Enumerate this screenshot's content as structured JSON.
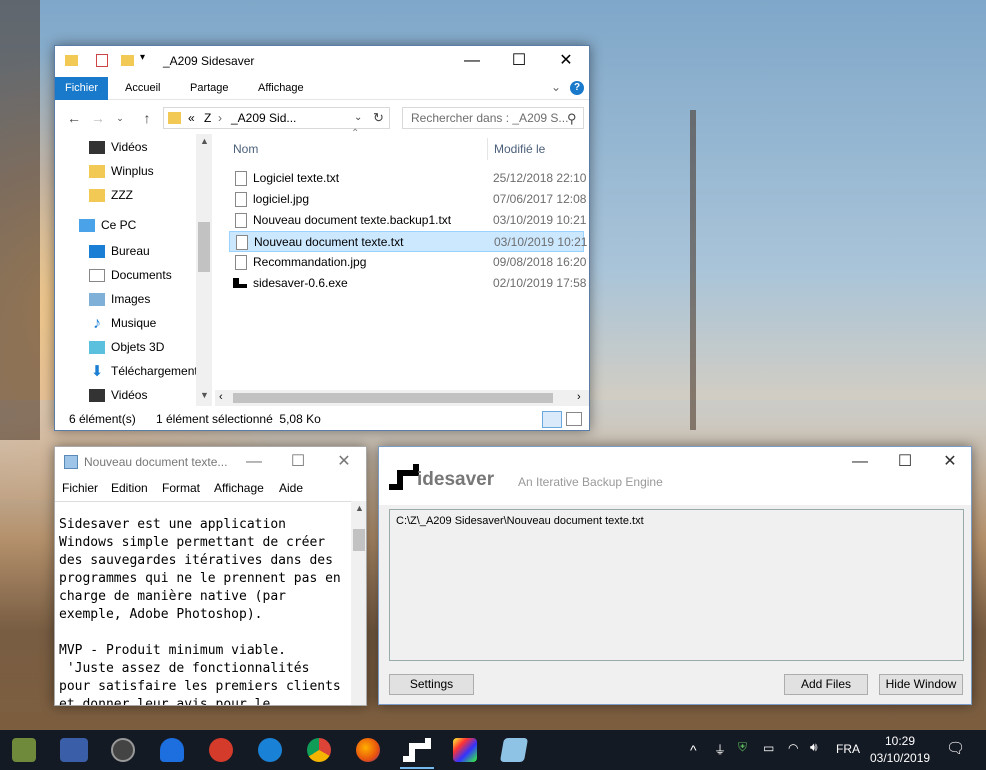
{
  "explorer": {
    "title": "_A209 Sidesaver",
    "tabs": [
      "Fichier",
      "Accueil",
      "Partage",
      "Affichage"
    ],
    "breadcrumb": [
      "«",
      "Z",
      "_A209 Sid..."
    ],
    "search_placeholder": "Rechercher dans : _A209 S...",
    "nav_items": [
      {
        "label": "Vidéos",
        "icon": "video-icon"
      },
      {
        "label": "Winplus",
        "icon": "folder-icon"
      },
      {
        "label": "ZZZ",
        "icon": "folder-icon"
      },
      {
        "label": "Ce PC",
        "icon": "computer-icon"
      },
      {
        "label": "Bureau",
        "icon": "desktop-icon"
      },
      {
        "label": "Documents",
        "icon": "documents-icon"
      },
      {
        "label": "Images",
        "icon": "images-icon"
      },
      {
        "label": "Musique",
        "icon": "music-icon"
      },
      {
        "label": "Objets 3D",
        "icon": "objects3d-icon"
      },
      {
        "label": "Téléchargements",
        "icon": "download-icon"
      },
      {
        "label": "Vidéos",
        "icon": "video-icon"
      }
    ],
    "columns": {
      "name": "Nom",
      "modified": "Modifié le"
    },
    "files": [
      {
        "name": "Logiciel texte.txt",
        "date": "25/12/2018 22:10"
      },
      {
        "name": "logiciel.jpg",
        "date": "07/06/2017 12:08"
      },
      {
        "name": "Nouveau document texte.backup1.txt",
        "date": "03/10/2019 10:21"
      },
      {
        "name": "Nouveau document texte.txt",
        "date": "03/10/2019 10:21"
      },
      {
        "name": "Recommandation.jpg",
        "date": "09/08/2018 16:20"
      },
      {
        "name": "sidesaver-0.6.exe",
        "date": "02/10/2019 17:58"
      }
    ],
    "selected_index": 3,
    "status_count": "6 élément(s)",
    "status_selection": "1 élément sélectionné  5,08 Ko"
  },
  "notepad": {
    "title": "Nouveau document texte...",
    "menu": [
      "Fichier",
      "Edition",
      "Format",
      "Affichage",
      "Aide"
    ],
    "lines": [
      "Sidesaver est une application",
      "Windows simple permettant de créer",
      "des sauvegardes itératives dans des",
      "programmes qui ne le prennent pas en",
      "charge de manière native (par",
      "exemple, Adobe Photoshop).",
      "",
      "MVP - Produit minimum viable.",
      " 'Juste assez de fonctionnalités",
      "pour satisfaire les premiers clients",
      "et donner leur avis pour le"
    ]
  },
  "sidesaver": {
    "logo_text": "idesaver",
    "subtitle": "An Iterative Backup Engine",
    "tracked_files": [
      "C:\\Z\\_A209 Sidesaver\\Nouveau document texte.txt"
    ],
    "buttons": {
      "settings": "Settings",
      "add_files": "Add Files",
      "hide_window": "Hide Window"
    }
  },
  "taskbar": {
    "language": "FRA",
    "time": "10:29",
    "date": "03/10/2019",
    "accent": "#1979ca"
  }
}
